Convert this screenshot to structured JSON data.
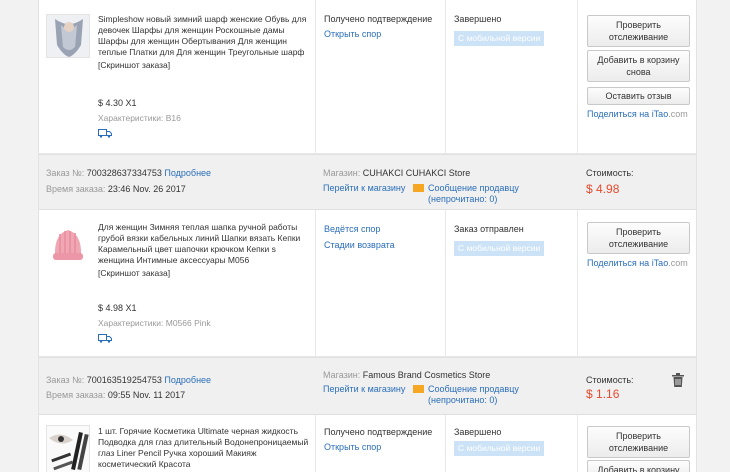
{
  "orders": [
    {
      "item": {
        "name": "Simpleshow новый зимний шарф женские Обувь для девочек Шарфы для женщин Роскошные дамы Шарфы для женщин Обертывания Для женщин теплые Платки для Для женщин Треугольные шарф",
        "snapshot": "[Скриншот заказа]",
        "price": "$ 4.30 X1",
        "characteristics": "Характеристики: B16",
        "thumb_icon": "scarf-photo",
        "status": "Получено подтверждение",
        "status_link": "Открыть спор",
        "order_status": "Завершено",
        "badge": "С мобильной версии",
        "buttons": [
          "Проверить отслеживание",
          "Добавить в корзину снова",
          "Оставить отзыв"
        ],
        "share_prefix": "Поделиться на ",
        "share_brand": "iTao",
        "share_suffix": ".com"
      }
    },
    {
      "header": {
        "order_label": "Заказ №: ",
        "order_no": "700328637334753",
        "more": "Подробнее",
        "time_label": "Время заказа: ",
        "time": "23:46 Nov. 26 2017",
        "store_label": "Магазин: ",
        "store_name": "CUHAKCI CUHAKCI Store",
        "goto_store": "Перейти к магазину",
        "message": "Сообщение продавцу",
        "unread": "(непрочитано: 0)",
        "cost_label": "Стоимость:",
        "cost": "$ 4.98"
      },
      "item": {
        "name": "Для женщин Зимняя теплая шапка ручной работы грубой вязки кабельных линий Шапки вязать Кепки Карамельный цвет шапочки крючком Кепки s женщина Интимные аксессуары M056",
        "snapshot": "[Скриншот заказа]",
        "price": "$ 4.98 X1",
        "characteristics": "Характеристики: M0566 Pink",
        "thumb_icon": "knit-hat-photo",
        "status": "Ведётся спор",
        "status_link": "Стадии возврата",
        "order_status": "Заказ отправлен",
        "badge": "С мобильной версии",
        "buttons": [
          "Проверить отслеживание"
        ],
        "share_prefix": "Поделиться на ",
        "share_brand": "iTao",
        "share_suffix": ".com"
      }
    },
    {
      "header": {
        "order_label": "Заказ №: ",
        "order_no": "700163519254753",
        "more": "Подробнее",
        "time_label": "Время заказа: ",
        "time": "09:55 Nov. 11 2017",
        "store_label": "Магазин: ",
        "store_name": "Famous Brand Cosmetics Store",
        "goto_store": "Перейти к магазину",
        "message": "Сообщение продавцу",
        "unread": "(непрочитано: 0)",
        "cost_label": "Стоимость:",
        "cost": "$ 1.16"
      },
      "item": {
        "name": "1 шт. Горячие Косметика Ultimate черная жидкость Подводка для глаз длительный Водонепроницаемый глаз Liner Pencil Ручка хороший Макияж косметический Красота",
        "thumb_icon": "eyeliner-photo",
        "status": "Получено подтверждение",
        "status_link": "Открыть спор",
        "order_status": "Завершено",
        "badge": "С мобильной версии",
        "buttons": [
          "Проверить отслеживание",
          "Добавить в корзину"
        ]
      }
    }
  ],
  "colors": {
    "link": "#2a6ebb",
    "price": "#e64a2e",
    "badge": "#cce3f7",
    "mail": "#f5a623"
  }
}
